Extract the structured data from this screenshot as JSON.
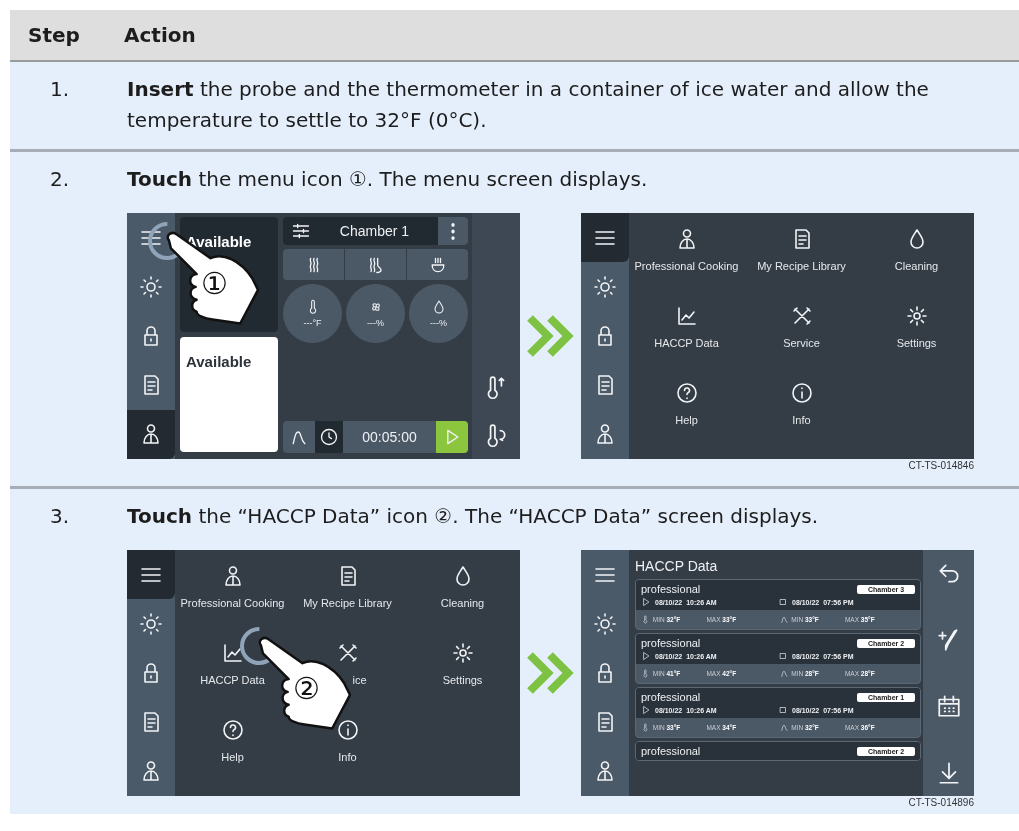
{
  "table": {
    "columns": [
      "Step",
      "Action"
    ],
    "rows": [
      {
        "step": "1.",
        "text": "**Insert** the probe and the thermometer in a container of ice water and allow the temperature to settle to 32°F (0°C)."
      },
      {
        "step": "2.",
        "text": "**Touch** the menu icon ①. The menu screen displays.",
        "figure": {
          "caption": "CT-TS-014846",
          "screens": [
            {
              "kind": "home",
              "callout": "①",
              "sidebar": [
                {
                  "selected": false
                },
                {
                  "selected": false
                },
                {
                  "selected": false
                },
                {
                  "selected": false
                },
                {
                  "selected": true
                }
              ],
              "cards": [
                {
                  "label": "Available",
                  "selected": false
                },
                {
                  "label": "Available",
                  "selected": true
                }
              ],
              "chamber": "Chamber 1",
              "dials": [
                "---°F",
                "---%",
                "---%"
              ],
              "timer": "00:05:00"
            },
            {
              "kind": "menu",
              "sidebar": [
                {
                  "selected": true
                },
                {
                  "selected": false
                },
                {
                  "selected": false
                },
                {
                  "selected": false
                },
                {
                  "selected": false
                }
              ],
              "items": [
                "Professional Cooking",
                "My Recipe Library",
                "Cleaning",
                "HACCP Data",
                "Service",
                "Settings",
                "Help",
                "Info"
              ]
            }
          ]
        }
      },
      {
        "step": "3.",
        "text": "**Touch** the “HACCP Data” icon ②. The “HACCP Data” screen displays.",
        "figure": {
          "caption": "CT-TS-014896",
          "screens": [
            {
              "kind": "menu",
              "callout": "②",
              "sidebar": [
                {
                  "selected": true
                },
                {
                  "selected": false
                },
                {
                  "selected": false
                },
                {
                  "selected": false
                },
                {
                  "selected": false
                }
              ],
              "items": [
                "Professional Cooking",
                "My Recipe Library",
                "Cleaning",
                "HACCP Data",
                "ice",
                "Settings",
                "Help",
                "Info"
              ]
            },
            {
              "kind": "haccp",
              "sidebar": [
                {
                  "selected": false
                },
                {
                  "selected": false
                },
                {
                  "selected": false
                },
                {
                  "selected": false
                },
                {
                  "selected": false
                }
              ],
              "title": "HACCP Data",
              "records": [
                {
                  "name": "professional",
                  "chamber": "Chamber 3",
                  "start": "08/10/22  10:26 AM",
                  "end": "08/10/22  07:56 PM",
                  "readings": [
                    "MIN **32°F**",
                    "MAX **33°F**",
                    "MIN **33°F**",
                    "MAX **35°F**"
                  ]
                },
                {
                  "name": "professional",
                  "chamber": "Chamber 2",
                  "start": "08/10/22  10:26 AM",
                  "end": "08/10/22  07:56 PM",
                  "readings": [
                    "MIN **41°F**",
                    "MAX **42°F**",
                    "MIN **28°F**",
                    "MAX **28°F**"
                  ]
                },
                {
                  "name": "professional",
                  "chamber": "Chamber 1",
                  "start": "08/10/22  10:26 AM",
                  "end": "08/10/22  07:56 PM",
                  "readings": [
                    "MIN **33°F**",
                    "MAX **34°F**",
                    "MIN **32°F**",
                    "MAX **36°F**"
                  ]
                },
                {
                  "name": "professional",
                  "chamber": "Chamber 2"
                }
              ]
            }
          ]
        }
      }
    ]
  }
}
